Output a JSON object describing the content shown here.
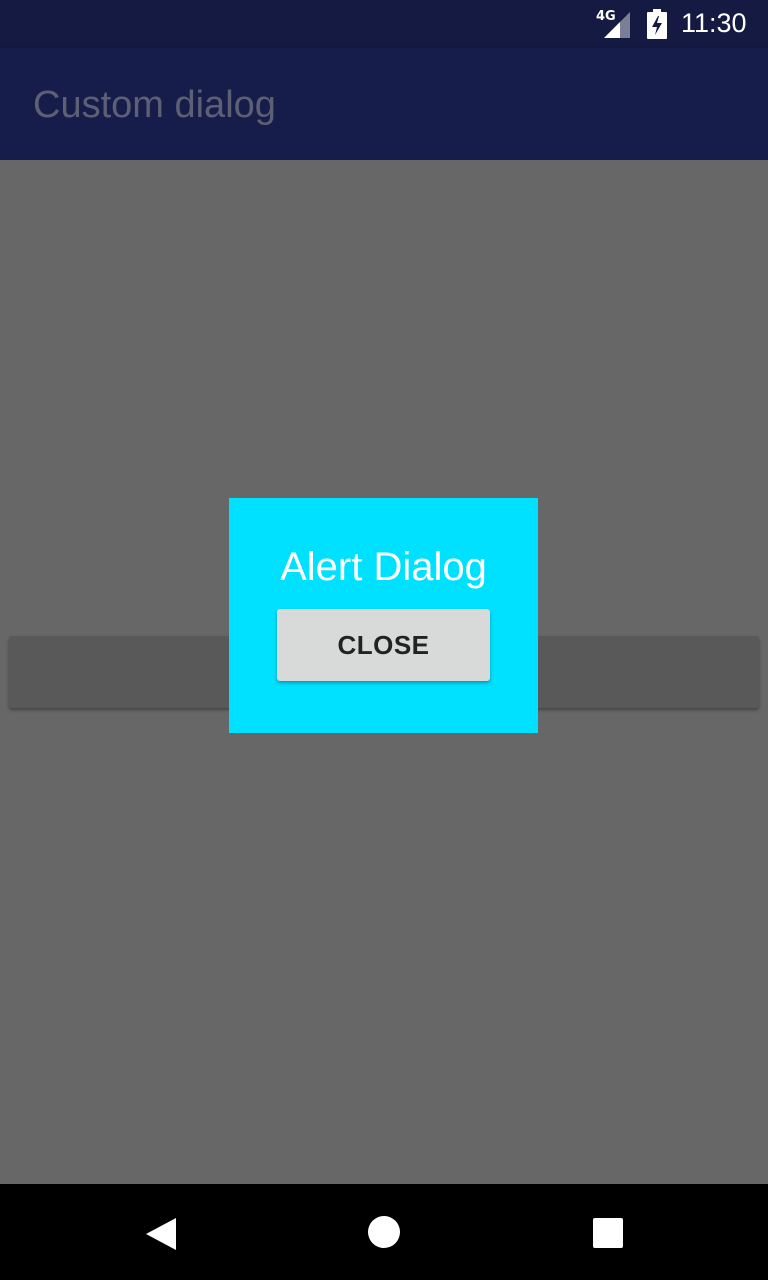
{
  "status_bar": {
    "network": "4G",
    "time": "11:30",
    "icons": [
      "signal-icon",
      "battery-charging-icon"
    ]
  },
  "app_bar": {
    "title": "Custom dialog"
  },
  "dialog": {
    "title": "Alert Dialog",
    "close_label": "CLOSE",
    "background_color": "#00e0ff"
  },
  "nav_bar": {
    "icons": [
      "back-icon",
      "home-icon",
      "recents-icon"
    ]
  }
}
